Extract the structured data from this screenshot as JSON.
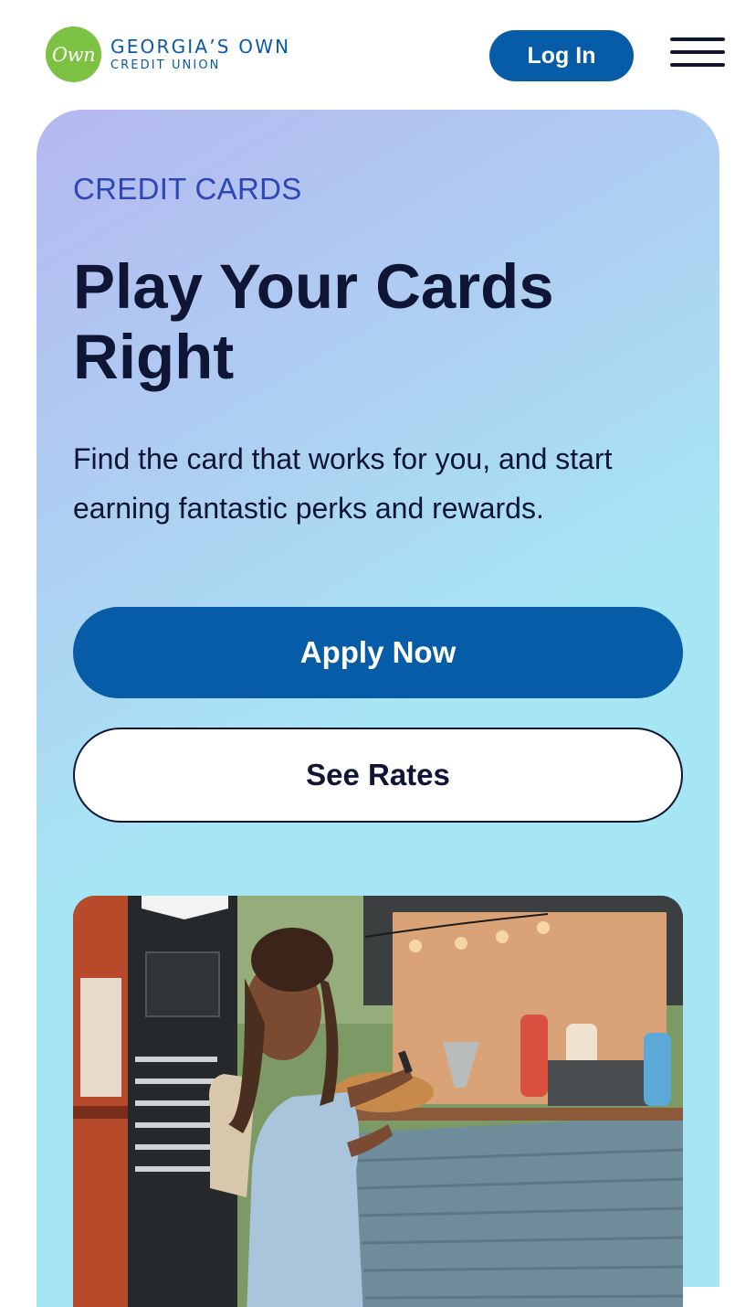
{
  "header": {
    "logo_mark": "Own",
    "logo_line1": "GEORGIA’S OWN",
    "logo_line2": "CREDIT UNION",
    "login_label": "Log In",
    "menu_icon": "hamburger-menu-icon"
  },
  "hero": {
    "eyebrow": "CREDIT CARDS",
    "title": "Play Your Cards Right",
    "description": "Find the card that works for you, and start earning fantastic perks and rewards.",
    "apply_label": "Apply Now",
    "rates_label": "See Rates",
    "photo_alt": "Woman smiling while paying with a card at a food truck"
  },
  "colors": {
    "brand_blue": "#075ca8",
    "logo_green": "#7cc142",
    "eyebrow_blue": "#2d47b8",
    "text_dark": "#0f1535",
    "gradient_start": "#b5b8f0",
    "gradient_end": "#a6e6f4"
  }
}
